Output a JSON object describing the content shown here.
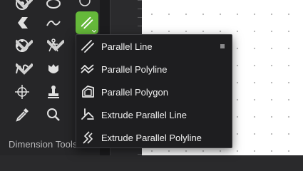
{
  "toolbar": {
    "section_label": "Dimension Tools",
    "tools": [
      {
        "name": "circle-tool-icon"
      },
      {
        "name": "ellipse-tool-icon"
      },
      {
        "name": "shape-tool-icon"
      },
      {
        "name": "curve-tool-icon"
      },
      {
        "name": "sphere-tool-icon"
      },
      {
        "name": "compass-tool-icon"
      },
      {
        "name": "freehand-tool-icon"
      },
      {
        "name": "mask-tool-icon"
      },
      {
        "name": "target-tool-icon"
      },
      {
        "name": "stamp-tool-icon"
      },
      {
        "name": "eyedropper-tool-icon"
      },
      {
        "name": "zoom-tool-icon"
      }
    ],
    "active_tool": {
      "name": "parallel-line-icon",
      "color": "#65b83a"
    }
  },
  "menu": {
    "items": [
      {
        "label": "Parallel Line",
        "icon": "parallel-line-icon",
        "selected": true
      },
      {
        "label": "Parallel Polyline",
        "icon": "parallel-polyline-icon"
      },
      {
        "label": "Parallel Polygon",
        "icon": "parallel-polygon-icon"
      },
      {
        "label": "Extrude Parallel Line",
        "icon": "extrude-parallel-line-icon"
      },
      {
        "label": "Extrude Parallel Polyline",
        "icon": "extrude-parallel-polyline-icon"
      }
    ]
  },
  "colors": {
    "toolbar_bg": "#262628",
    "menu_bg": "#1e1e20",
    "accent": "#65b83a",
    "canvas_bg": "#ffffff"
  }
}
